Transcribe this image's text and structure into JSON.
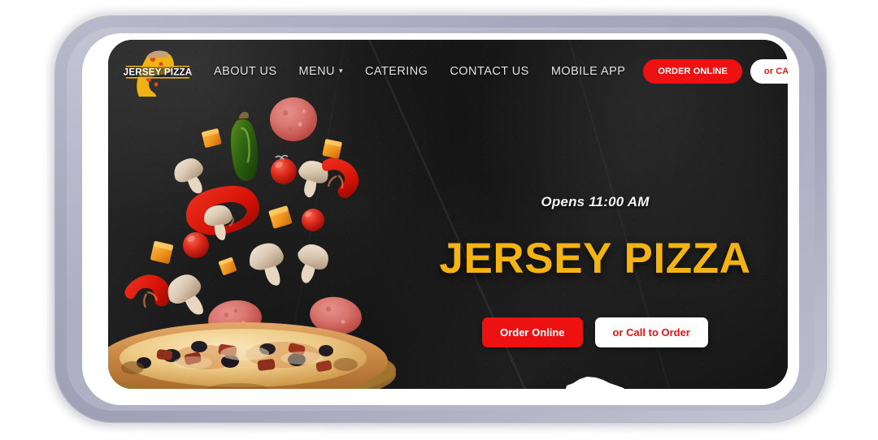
{
  "site": {
    "brand_name": "JERSEY PIZZA",
    "logo_text": "JERSEY PIZZA"
  },
  "nav": {
    "links": [
      {
        "label": "ABOUT US",
        "has_caret": false
      },
      {
        "label": "MENU",
        "has_caret": true
      },
      {
        "label": "CATERING",
        "has_caret": false
      },
      {
        "label": "CONTACT US",
        "has_caret": false
      },
      {
        "label": "MOBILE APP",
        "has_caret": false
      }
    ],
    "caret_glyph": "▾",
    "order_online_label": "ORDER ONLINE",
    "call_to_order_label": "or CALL TO ORDER"
  },
  "hero": {
    "kicker": "Opens 11:00 AM",
    "title": "JERSEY PIZZA",
    "order_online_label": "Order Online",
    "call_to_order_label": "or Call to Order"
  },
  "colors": {
    "brand_red": "#ee1111",
    "brand_gold": "#f2b313",
    "screen_dark": "#141414",
    "bezel_white": "#ffffff",
    "frame_lavender": "#a7a8bd",
    "nav_text": "#e2e2e2"
  },
  "imagery": {
    "description": "Dark textured chalkboard background with falling pizza toppings above a whole pizza on a wooden board",
    "toppings": [
      "salami-slice",
      "salami-slice",
      "salami-slice",
      "salami-slice",
      "mushroom",
      "mushroom",
      "mushroom",
      "mushroom",
      "mushroom",
      "mushroom",
      "red-pepper-ring",
      "red-pepper-ring",
      "red-pepper-ring",
      "cherry-tomato",
      "cherry-tomato",
      "cherry-tomato",
      "cherry-tomato",
      "cherry-tomato",
      "cheese-cube",
      "cheese-cube",
      "cheese-cube",
      "cheese-cube",
      "cheese-cube",
      "cheese-cube",
      "cheese-cube",
      "jalapeno-pepper"
    ]
  }
}
